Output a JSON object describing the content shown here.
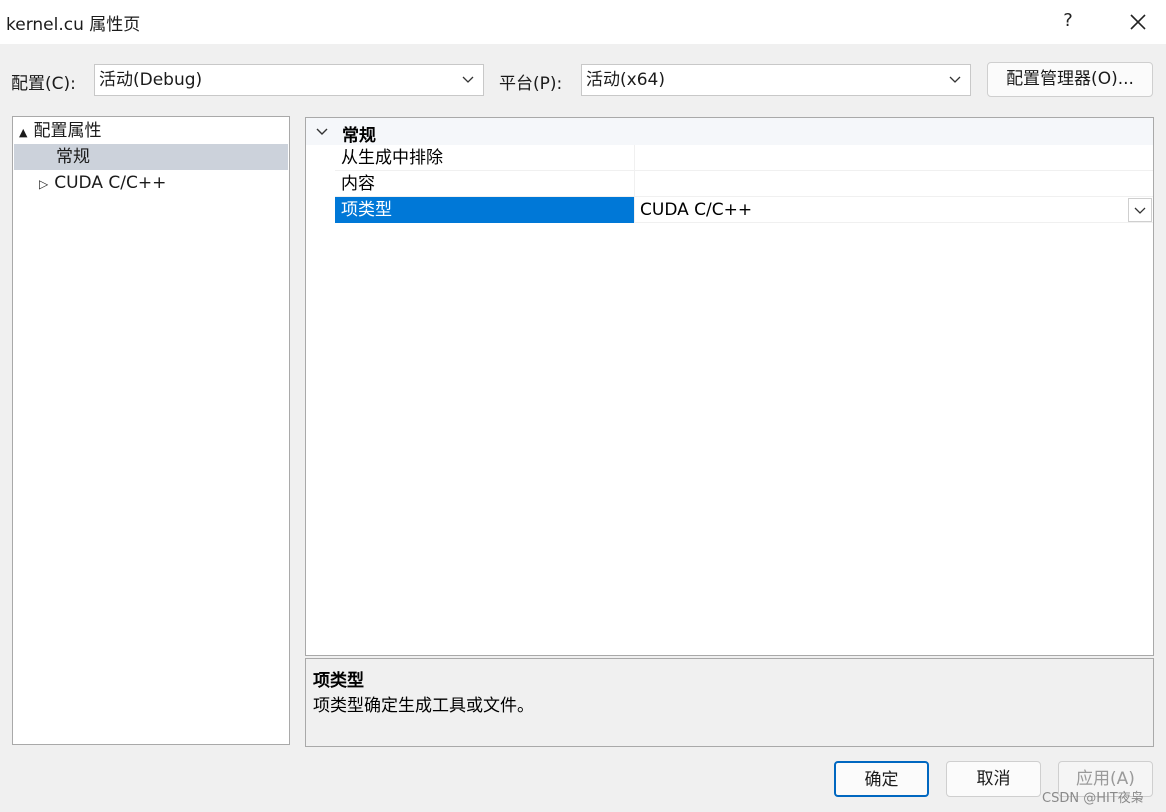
{
  "window": {
    "title": "kernel.cu 属性页",
    "help_label": "?"
  },
  "config_bar": {
    "config_label": "配置(C):",
    "config_value": "活动(Debug)",
    "platform_label": "平台(P):",
    "platform_value": "活动(x64)",
    "manager_button": "配置管理器(O)..."
  },
  "tree": {
    "items": [
      {
        "label": "配置属性",
        "expander": "▲",
        "expanded": true
      },
      {
        "label": "常规",
        "selected": true
      },
      {
        "label": "CUDA C/C++",
        "expander": "▷",
        "expanded": false
      }
    ]
  },
  "grid": {
    "category": "常规",
    "rows": [
      {
        "name": "从生成中排除",
        "value": ""
      },
      {
        "name": "内容",
        "value": ""
      },
      {
        "name": "项类型",
        "value": "CUDA C/C++",
        "selected": true
      }
    ]
  },
  "description": {
    "title": "项类型",
    "text": "项类型确定生成工具或文件。"
  },
  "footer": {
    "ok_label": "确定",
    "cancel_label": "取消",
    "apply_label": "应用(A)"
  },
  "watermark": "CSDN @HIT夜枭",
  "colors": {
    "selection_blue": "#0078d7",
    "tree_selection": "#ccd2db",
    "ok_border": "#0067c0"
  }
}
